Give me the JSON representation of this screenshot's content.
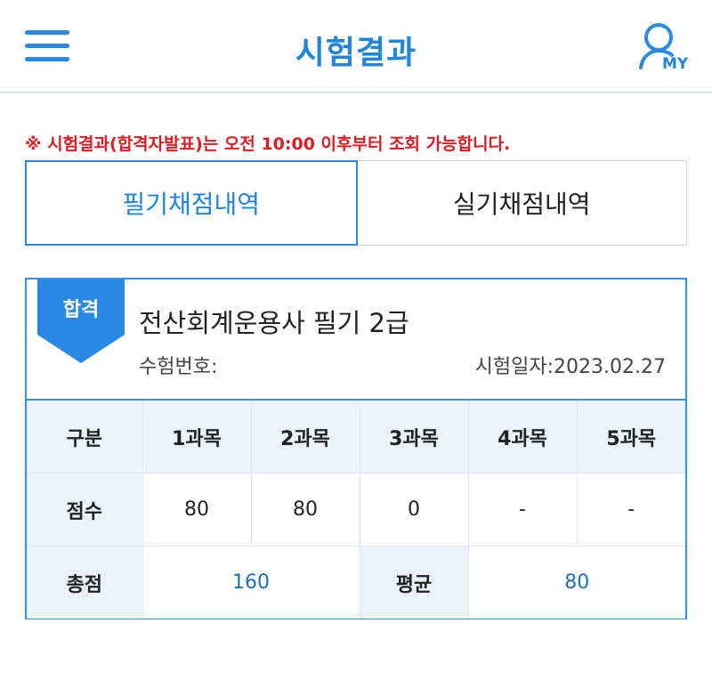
{
  "header": {
    "title": "시험결과",
    "my_label": "MY"
  },
  "notice": "※ 시험결과(합격자발표)는 오전 10:00 이후부터 조회 가능합니다.",
  "tabs": [
    {
      "label": "필기채점내역",
      "active": true
    },
    {
      "label": "실기채점내역",
      "active": false
    }
  ],
  "result": {
    "badge": "합격",
    "exam_name": "전산회계운용사 필기 2급",
    "exam_number_label": "수험번호:",
    "exam_date_label": "시험일자:2023.02.27"
  },
  "table": {
    "header": [
      "구분",
      "1과목",
      "2과목",
      "3과목",
      "4과목",
      "5과목"
    ],
    "score_row": [
      "점수",
      "80",
      "80",
      "0",
      "-",
      "-"
    ],
    "total_label": "총점",
    "total_value": "160",
    "average_label": "평균",
    "average_value": "80"
  },
  "colors": {
    "accent": "#1f86df",
    "notice": "#e11b22",
    "header_cell_bg": "#eaf2fb"
  },
  "icons": [
    "hamburger-menu-icon",
    "user-icon"
  ]
}
